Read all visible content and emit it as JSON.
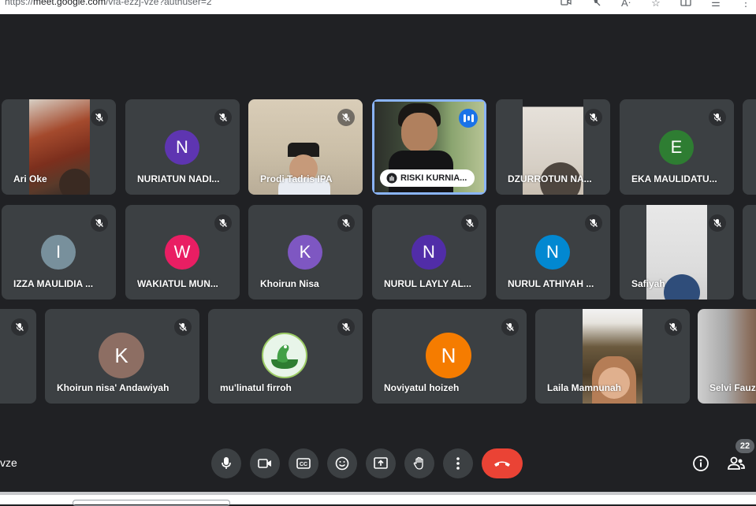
{
  "browser": {
    "url_prefix": "https://",
    "url_host": "meet.google.com",
    "url_path": "/vfa-ezzj-vze?authuser=2",
    "toolbar_icons": [
      "camera-icon",
      "mic-off-icon",
      "read-aloud-icon",
      "favorite-star-icon",
      "split-screen-icon",
      "favorites-icon",
      "more-icon"
    ]
  },
  "participants": [
    {
      "name": "Ari Oke",
      "type": "video",
      "muted": true
    },
    {
      "name": "NURIATUN NADI...",
      "type": "avatar",
      "initial": "N",
      "color": "#5e35b1",
      "muted": true
    },
    {
      "name": "Prodi Tadris IPA",
      "type": "video",
      "muted": true
    },
    {
      "name": "RISKI KURNIA...",
      "type": "video",
      "speaking": true,
      "pinned_label": true
    },
    {
      "name": "DZURROTUN NA...",
      "type": "video",
      "muted": true
    },
    {
      "name": "EKA MAULIDATU...",
      "type": "avatar",
      "initial": "E",
      "color": "#2e7d32",
      "muted": true
    },
    {
      "name": "IZZA MAULIDIA ...",
      "type": "avatar",
      "initial": "I",
      "color": "#78909c",
      "muted": true
    },
    {
      "name": "WAKIATUL MUN...",
      "type": "avatar",
      "initial": "W",
      "color": "#e91e63",
      "muted": true
    },
    {
      "name": "Khoirun Nisa",
      "type": "avatar",
      "initial": "K",
      "color": "#7e57c2",
      "muted": true
    },
    {
      "name": "NURUL LAYLY AL...",
      "type": "avatar",
      "initial": "N",
      "color": "#512da8",
      "muted": true
    },
    {
      "name": "NURUL ATHIYAH ...",
      "type": "avatar",
      "initial": "N",
      "color": "#0288d1",
      "muted": true
    },
    {
      "name": "Safiyah",
      "type": "video",
      "muted": true
    },
    {
      "name": "Khoirun nisa' Andawiyah",
      "type": "avatar",
      "initial": "K",
      "color": "#8d6e63",
      "muted": true
    },
    {
      "name": "mu'linatul firroh",
      "type": "image-avatar",
      "muted": true
    },
    {
      "name": "Noviyatul hoizeh",
      "type": "avatar",
      "initial": "N",
      "color": "#f57c00",
      "muted": true
    },
    {
      "name": "Laila Mamnunah",
      "type": "video",
      "muted": true
    },
    {
      "name": "Selvi Fauz",
      "type": "video",
      "muted": false
    }
  ],
  "meeting": {
    "code_fragment": "vze",
    "participant_count": "22",
    "controls": [
      {
        "name": "microphone-button",
        "icon": "mic-icon"
      },
      {
        "name": "camera-button",
        "icon": "video-icon"
      },
      {
        "name": "captions-button",
        "icon": "cc-icon"
      },
      {
        "name": "reactions-button",
        "icon": "emoji-icon"
      },
      {
        "name": "present-button",
        "icon": "present-icon"
      },
      {
        "name": "raise-hand-button",
        "icon": "hand-icon"
      },
      {
        "name": "more-options-button",
        "icon": "more-vert-icon"
      },
      {
        "name": "leave-call-button",
        "icon": "end-call-icon"
      }
    ],
    "colors": {
      "end_call": "#ea4335",
      "speaking": "#1a73e8",
      "active_outline": "#8ab4f8",
      "tile_bg": "#3c4043",
      "page_bg": "#202124"
    }
  }
}
